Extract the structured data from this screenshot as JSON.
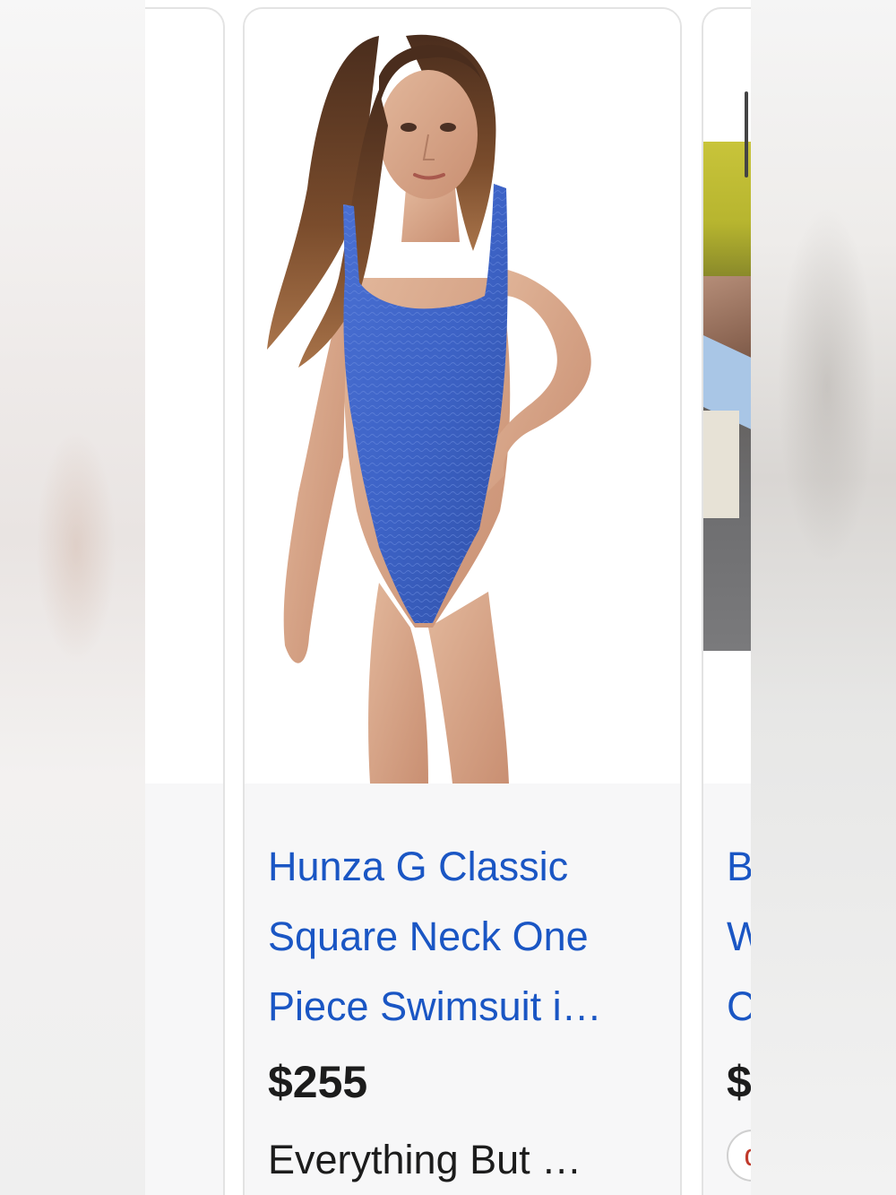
{
  "carousel": {
    "main_card": {
      "title_lines": [
        "Hunza G Classic",
        "Square Neck One",
        "Piece Swimsuit i…"
      ],
      "price": "$255",
      "merchant": "Everything But …",
      "image_alt": "blue one piece swimsuit"
    },
    "next_card": {
      "title_initials": [
        "B",
        "W",
        "C"
      ],
      "price_initial": "$",
      "logo_glyph": "d"
    }
  },
  "colors": {
    "link_blue": "#1a56c4",
    "swimsuit_blue": "#3d63c6",
    "card_border": "#e3e3e3"
  }
}
